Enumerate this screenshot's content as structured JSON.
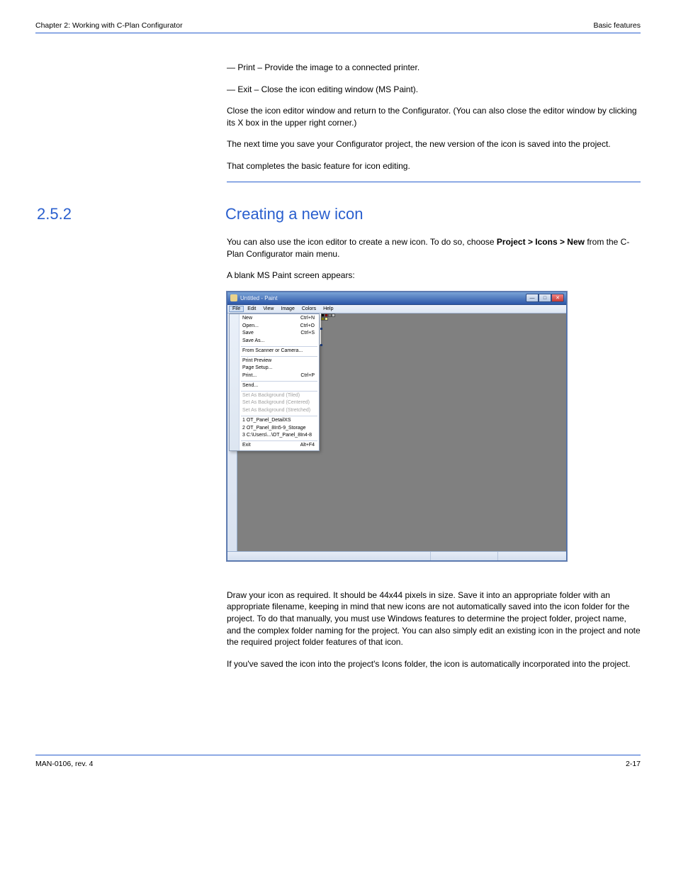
{
  "header": {
    "left": "Chapter 2:  Working with C-Plan Configurator",
    "right": "Basic features"
  },
  "intro": {
    "p1": "— Print – Provide the image to a connected printer.",
    "p2": "— Exit – Close the icon editing window (MS Paint).",
    "p3": "Close the icon editor window and return to the Configurator. (You can also close the editor window by clicking its X box in the upper right corner.)",
    "p4": "The next time you save your Configurator project, the new version of the icon is saved into the project.",
    "p5": "That completes the basic feature for icon editing."
  },
  "section": {
    "num": "2.5.2",
    "title": "Creating a new icon"
  },
  "sec_body": {
    "p1_a": "You can also use the icon editor to create a new icon. To do so, choose ",
    "p1_b": "Project > Icons > New",
    "p1_c": " from the C-Plan Configurator main menu.",
    "p2": "A blank MS Paint screen appears:"
  },
  "paint": {
    "title": "Untitled - Paint",
    "menubar": [
      "File",
      "Edit",
      "View",
      "Image",
      "Colors",
      "Help"
    ],
    "menu": {
      "items": [
        {
          "label": "New",
          "shortcut": "Ctrl+N",
          "disabled": false
        },
        {
          "label": "Open...",
          "shortcut": "Ctrl+O",
          "disabled": false
        },
        {
          "label": "Save",
          "shortcut": "Ctrl+S",
          "disabled": false
        },
        {
          "label": "Save As...",
          "shortcut": "",
          "disabled": false
        },
        {
          "sep": true
        },
        {
          "label": "From Scanner or Camera...",
          "shortcut": "",
          "disabled": false
        },
        {
          "sep": true
        },
        {
          "label": "Print Preview",
          "shortcut": "",
          "disabled": false
        },
        {
          "label": "Page Setup...",
          "shortcut": "",
          "disabled": false
        },
        {
          "label": "Print...",
          "shortcut": "Ctrl+P",
          "disabled": false
        },
        {
          "sep": true
        },
        {
          "label": "Send...",
          "shortcut": "",
          "disabled": false
        },
        {
          "sep": true
        },
        {
          "label": "Set As Background (Tiled)",
          "shortcut": "",
          "disabled": true
        },
        {
          "label": "Set As Background (Centered)",
          "shortcut": "",
          "disabled": true
        },
        {
          "label": "Set As Background (Stretched)",
          "shortcut": "",
          "disabled": true
        },
        {
          "sep": true
        },
        {
          "label": "1 OT_Panel_DetailXS",
          "shortcut": "",
          "disabled": false
        },
        {
          "label": "2 OT_Panel_8In5-9_Storage",
          "shortcut": "",
          "disabled": false
        },
        {
          "label": "3 C:\\Users\\...\\OT_Panel_8In4-8",
          "shortcut": "",
          "disabled": false
        },
        {
          "sep": true
        },
        {
          "label": "Exit",
          "shortcut": "Alt+F4",
          "disabled": false
        }
      ]
    },
    "colors": [
      "#000000",
      "#808080",
      "#800000",
      "#808000",
      "#008000",
      "#4f8fc0",
      "#384f9a",
      "#e3e663"
    ]
  },
  "post": {
    "p1": "Draw your icon as required. It should be 44x44 pixels in size. Save it into an appropriate folder with an appropriate filename, keeping in mind that new icons are not automatically saved into the icon folder for the project. To do that manually, you must use Windows features to determine the project folder, project name, and the complex folder naming for the project. You can also simply edit an existing icon in the project and note the required project folder features of that icon.",
    "p2": "If you've saved the icon into the project's Icons folder, the icon is automatically incorporated into the project."
  },
  "footer": {
    "left": "MAN-0106, rev. 4",
    "right": "2-17"
  }
}
